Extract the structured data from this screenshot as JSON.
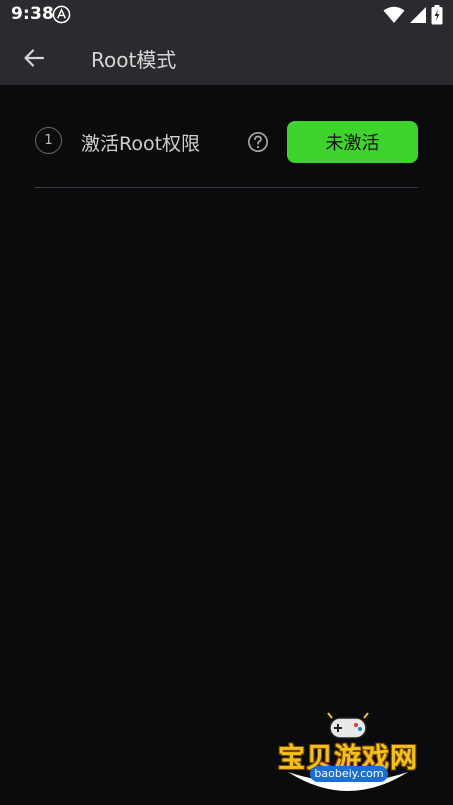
{
  "status_bar": {
    "time": "9:38",
    "icons": [
      "notification-icon",
      "wifi-icon",
      "signal-icon",
      "battery-icon"
    ]
  },
  "app_bar": {
    "back_icon": "arrow-left-icon",
    "title": "Root模式"
  },
  "steps": [
    {
      "number": "1",
      "label": "激活Root权限",
      "help_icon": "question-circle-icon",
      "button_label": "未激活"
    }
  ],
  "watermark": {
    "text": "宝贝游戏网",
    "subtext": "baobeiy.com"
  },
  "colors": {
    "background": "#0a0b0d",
    "bar_background": "#2a2b2e",
    "accent_green": "#3fd32e",
    "divider": "#3a3b3e"
  }
}
